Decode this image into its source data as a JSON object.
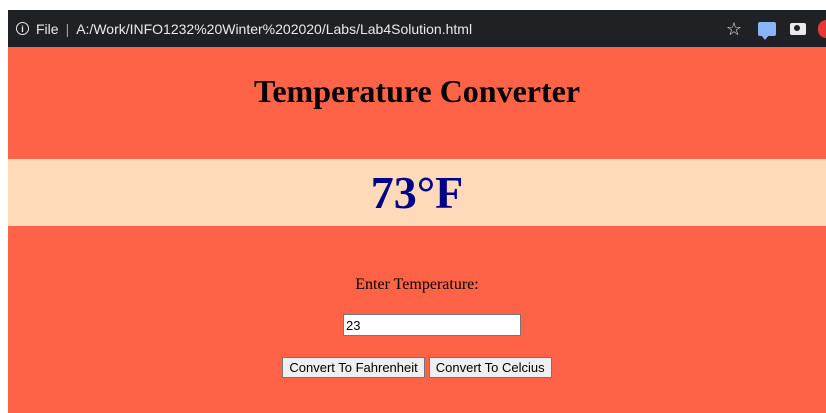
{
  "browser": {
    "info_glyph": "i",
    "file_label": "File",
    "separator": "|",
    "url": "A:/Work/INFO1232%20Winter%202020/Labs/Lab4Solution.html",
    "star_glyph": "☆"
  },
  "page": {
    "title": "Temperature Converter",
    "result": "73°F",
    "prompt_label": "Enter Temperature:",
    "input_value": "23",
    "buttons": {
      "to_fahrenheit": "Convert To Fahrenheit",
      "to_celcius": "Convert To Celcius"
    }
  },
  "colors": {
    "page_background": "#ff6347",
    "result_band": "#ffdab9",
    "result_text": "#00008b",
    "chrome_bar": "#202124"
  }
}
